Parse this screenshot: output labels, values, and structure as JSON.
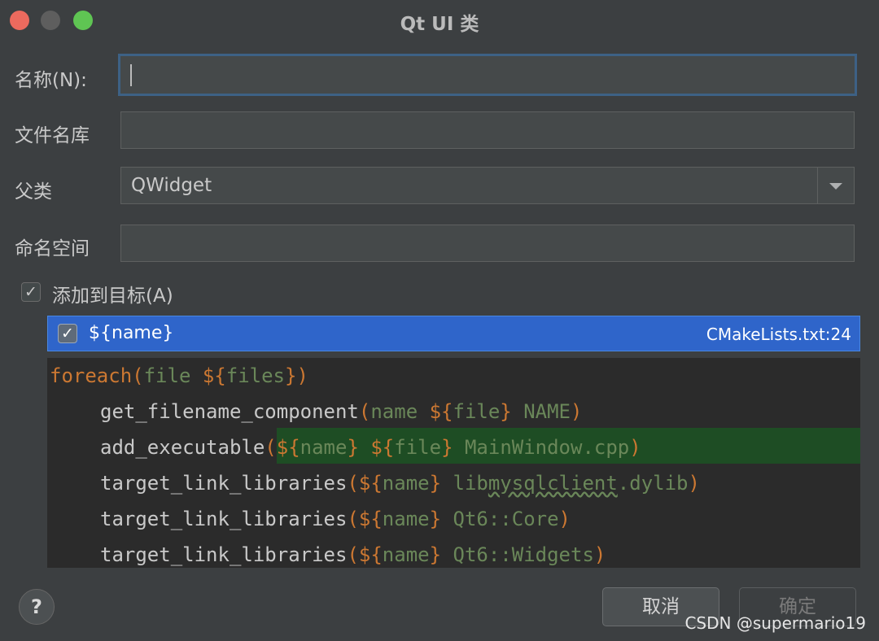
{
  "window": {
    "title": "Qt UI 类"
  },
  "form": {
    "name_label": "名称(N):",
    "name_value": "",
    "filename_label": "文件名库",
    "filename_value": "",
    "parent_label": "父类",
    "parent_value": "QWidget",
    "namespace_label": "命名空间",
    "namespace_value": ""
  },
  "add_to_target": {
    "label": "添加到目标(A)",
    "checked": true
  },
  "targets": [
    {
      "name": "${name}",
      "file": "CMakeLists.txt:24",
      "checked": true
    }
  ],
  "code_preview": {
    "lines": [
      "foreach(file ${files})",
      "    get_filename_component(name ${file} NAME)",
      "    add_executable(${name} ${file} MainWindow.cpp)",
      "    target_link_libraries(${name} libmysqlclient.dylib)",
      "    target_link_libraries(${name} Qt6::Core)",
      "    target_link_libraries(${name} Qt6::Widgets)"
    ]
  },
  "buttons": {
    "help": "?",
    "cancel": "取消",
    "ok": "确定"
  },
  "watermark": "CSDN @supermario19",
  "colors": {
    "background": "#3c3f41",
    "selection": "#2f65ca",
    "highlight": "#1e4d24",
    "keyword": "#cc7832",
    "string": "#6a8759"
  }
}
